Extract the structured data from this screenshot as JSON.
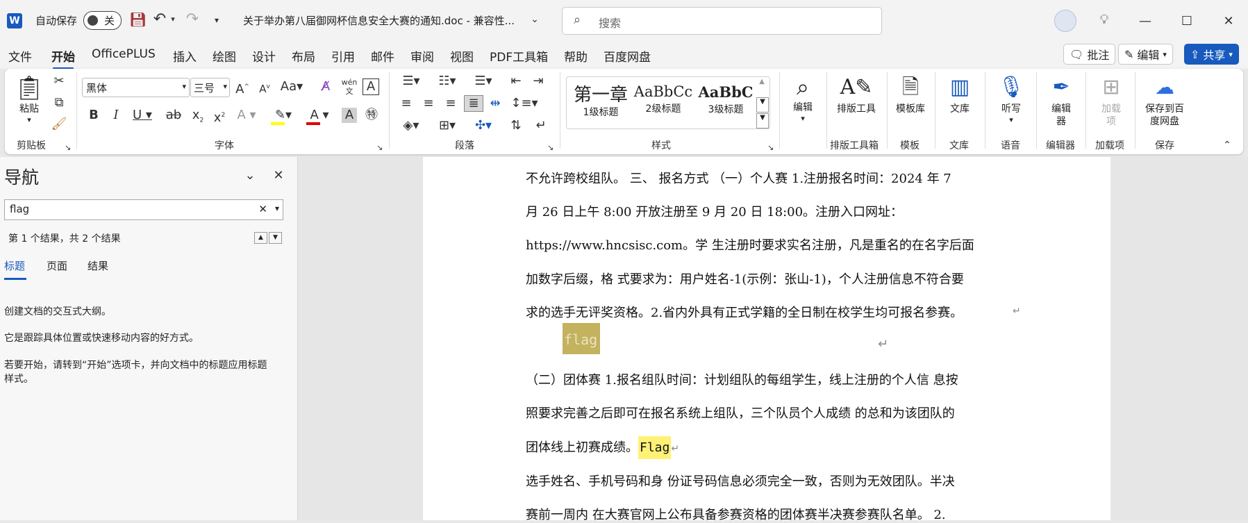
{
  "titlebar": {
    "app_icon": "W",
    "autosave_label": "自动保存",
    "autosave_state": "关",
    "doc_title": "关于举办第八届御网杯信息安全大赛的通知.doc  -  兼容性...",
    "search_placeholder": "搜索"
  },
  "tabs": [
    "文件",
    "开始",
    "OfficePLUS",
    "插入",
    "绘图",
    "设计",
    "布局",
    "引用",
    "邮件",
    "审阅",
    "视图",
    "PDF工具箱",
    "帮助",
    "百度网盘"
  ],
  "actions": {
    "comment": "批注",
    "edit": "编辑",
    "share": "共享"
  },
  "ribbon": {
    "clipboard": {
      "paste": "粘贴",
      "label": "剪贴板"
    },
    "font": {
      "name": "黑体",
      "size": "三号",
      "label": "字体"
    },
    "paragraph": {
      "label": "段落"
    },
    "styles": {
      "items": [
        {
          "preview": "第一章",
          "name": "1级标题"
        },
        {
          "preview": "AaBbCc",
          "name": "2级标题"
        },
        {
          "preview": "AaBbC",
          "name": "3级标题"
        }
      ],
      "label": "样式"
    },
    "edit_btn": "编辑",
    "layout_tool": "排版工具",
    "layout_tool_group": "排版工具箱",
    "template": "模板库",
    "template_group": "模板",
    "library": "文库",
    "library_group": "文库",
    "dictate": "听写",
    "voice_group": "语音",
    "editor": "编辑器",
    "editor_group": "编辑器",
    "addins": "加载项",
    "addins_group": "加载项",
    "save_baidu": "保存到百度网盘",
    "save_group": "保存"
  },
  "nav": {
    "title": "导航",
    "search_value": "flag",
    "result": "第 1 个结果，共 2 个结果",
    "tabs": [
      "标题",
      "页面",
      "结果"
    ],
    "help1": "创建文档的交互式大纲。",
    "help2": "它是跟踪具体位置或快速移动内容的好方式。",
    "help3a": "若要开始，请转到“开始”选项卡，并向文档中的标题应用标题",
    "help3b": "样式。"
  },
  "doc": {
    "line1": "不允许跨校组队。 三、 报名方式 （一）个人赛 1.注册报名时间：2024 年 7",
    "line2": "月  26  日上午  8:00  开放注册至  9  月  20  日  18:00。注册入口网址：",
    "line3": "https://www.hncsisc.com。学 生注册时要求实名注册，凡是重名的在名字后面",
    "line4": "加数字后缀，格 式要求为：用户姓名-1(示例：张山-1)，个人注册信息不符合要",
    "line5": "求的选手无评奖资格。2.省内外具有正式学籍的全日制在校学生均可报名参赛。",
    "flag1": "flag",
    "line6": "（二）团体赛 1.报名组队时间：计划组队的每组学生，线上注册的个人信 息按",
    "line7": "照要求完善之后即可在报名系统上组队，三个队员个人成绩 的总和为该团队的",
    "line8a": "团体线上初赛成绩。",
    "flag2": "Flag",
    "line9": "选手姓名、手机号码和身 份证号码信息必须完全一致，否则为无效团队。半决",
    "line10": "赛前一周内 在大赛官网上公布具备参赛资格的团体赛半决赛参赛队名单。 2."
  }
}
